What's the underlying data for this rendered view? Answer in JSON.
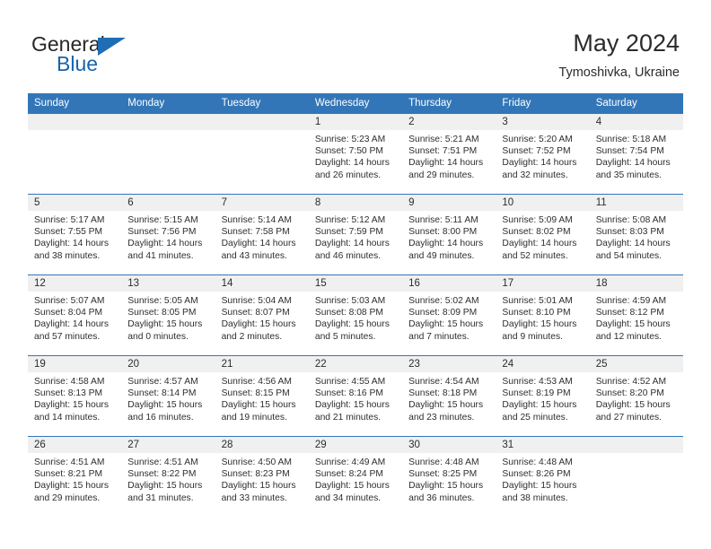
{
  "brand": {
    "word1": "General",
    "word2": "Blue",
    "triangle_icon": "brand-triangle-icon",
    "accent_color": "#1f6eb5"
  },
  "header": {
    "title": "May 2024",
    "subtitle": "Tymoshivka, Ukraine"
  },
  "colors": {
    "header_blue": "#3276b8",
    "daynum_band": "#f0f0f0",
    "text": "#2b2b2b"
  },
  "calendar": {
    "weekday_headers": [
      "Sunday",
      "Monday",
      "Tuesday",
      "Wednesday",
      "Thursday",
      "Friday",
      "Saturday"
    ],
    "labels": {
      "sunrise": "Sunrise:",
      "sunset": "Sunset:",
      "daylight": "Daylight:"
    },
    "weeks": [
      [
        {
          "blank": true
        },
        {
          "blank": true
        },
        {
          "blank": true
        },
        {
          "day": "1",
          "sunrise": "Sunrise: 5:23 AM",
          "sunset": "Sunset: 7:50 PM",
          "daylight_a": "Daylight: 14 hours",
          "daylight_b": "and 26 minutes."
        },
        {
          "day": "2",
          "sunrise": "Sunrise: 5:21 AM",
          "sunset": "Sunset: 7:51 PM",
          "daylight_a": "Daylight: 14 hours",
          "daylight_b": "and 29 minutes."
        },
        {
          "day": "3",
          "sunrise": "Sunrise: 5:20 AM",
          "sunset": "Sunset: 7:52 PM",
          "daylight_a": "Daylight: 14 hours",
          "daylight_b": "and 32 minutes."
        },
        {
          "day": "4",
          "sunrise": "Sunrise: 5:18 AM",
          "sunset": "Sunset: 7:54 PM",
          "daylight_a": "Daylight: 14 hours",
          "daylight_b": "and 35 minutes."
        }
      ],
      [
        {
          "day": "5",
          "sunrise": "Sunrise: 5:17 AM",
          "sunset": "Sunset: 7:55 PM",
          "daylight_a": "Daylight: 14 hours",
          "daylight_b": "and 38 minutes."
        },
        {
          "day": "6",
          "sunrise": "Sunrise: 5:15 AM",
          "sunset": "Sunset: 7:56 PM",
          "daylight_a": "Daylight: 14 hours",
          "daylight_b": "and 41 minutes."
        },
        {
          "day": "7",
          "sunrise": "Sunrise: 5:14 AM",
          "sunset": "Sunset: 7:58 PM",
          "daylight_a": "Daylight: 14 hours",
          "daylight_b": "and 43 minutes."
        },
        {
          "day": "8",
          "sunrise": "Sunrise: 5:12 AM",
          "sunset": "Sunset: 7:59 PM",
          "daylight_a": "Daylight: 14 hours",
          "daylight_b": "and 46 minutes."
        },
        {
          "day": "9",
          "sunrise": "Sunrise: 5:11 AM",
          "sunset": "Sunset: 8:00 PM",
          "daylight_a": "Daylight: 14 hours",
          "daylight_b": "and 49 minutes."
        },
        {
          "day": "10",
          "sunrise": "Sunrise: 5:09 AM",
          "sunset": "Sunset: 8:02 PM",
          "daylight_a": "Daylight: 14 hours",
          "daylight_b": "and 52 minutes."
        },
        {
          "day": "11",
          "sunrise": "Sunrise: 5:08 AM",
          "sunset": "Sunset: 8:03 PM",
          "daylight_a": "Daylight: 14 hours",
          "daylight_b": "and 54 minutes."
        }
      ],
      [
        {
          "day": "12",
          "sunrise": "Sunrise: 5:07 AM",
          "sunset": "Sunset: 8:04 PM",
          "daylight_a": "Daylight: 14 hours",
          "daylight_b": "and 57 minutes."
        },
        {
          "day": "13",
          "sunrise": "Sunrise: 5:05 AM",
          "sunset": "Sunset: 8:05 PM",
          "daylight_a": "Daylight: 15 hours",
          "daylight_b": "and 0 minutes."
        },
        {
          "day": "14",
          "sunrise": "Sunrise: 5:04 AM",
          "sunset": "Sunset: 8:07 PM",
          "daylight_a": "Daylight: 15 hours",
          "daylight_b": "and 2 minutes."
        },
        {
          "day": "15",
          "sunrise": "Sunrise: 5:03 AM",
          "sunset": "Sunset: 8:08 PM",
          "daylight_a": "Daylight: 15 hours",
          "daylight_b": "and 5 minutes."
        },
        {
          "day": "16",
          "sunrise": "Sunrise: 5:02 AM",
          "sunset": "Sunset: 8:09 PM",
          "daylight_a": "Daylight: 15 hours",
          "daylight_b": "and 7 minutes."
        },
        {
          "day": "17",
          "sunrise": "Sunrise: 5:01 AM",
          "sunset": "Sunset: 8:10 PM",
          "daylight_a": "Daylight: 15 hours",
          "daylight_b": "and 9 minutes."
        },
        {
          "day": "18",
          "sunrise": "Sunrise: 4:59 AM",
          "sunset": "Sunset: 8:12 PM",
          "daylight_a": "Daylight: 15 hours",
          "daylight_b": "and 12 minutes."
        }
      ],
      [
        {
          "day": "19",
          "sunrise": "Sunrise: 4:58 AM",
          "sunset": "Sunset: 8:13 PM",
          "daylight_a": "Daylight: 15 hours",
          "daylight_b": "and 14 minutes."
        },
        {
          "day": "20",
          "sunrise": "Sunrise: 4:57 AM",
          "sunset": "Sunset: 8:14 PM",
          "daylight_a": "Daylight: 15 hours",
          "daylight_b": "and 16 minutes."
        },
        {
          "day": "21",
          "sunrise": "Sunrise: 4:56 AM",
          "sunset": "Sunset: 8:15 PM",
          "daylight_a": "Daylight: 15 hours",
          "daylight_b": "and 19 minutes."
        },
        {
          "day": "22",
          "sunrise": "Sunrise: 4:55 AM",
          "sunset": "Sunset: 8:16 PM",
          "daylight_a": "Daylight: 15 hours",
          "daylight_b": "and 21 minutes."
        },
        {
          "day": "23",
          "sunrise": "Sunrise: 4:54 AM",
          "sunset": "Sunset: 8:18 PM",
          "daylight_a": "Daylight: 15 hours",
          "daylight_b": "and 23 minutes."
        },
        {
          "day": "24",
          "sunrise": "Sunrise: 4:53 AM",
          "sunset": "Sunset: 8:19 PM",
          "daylight_a": "Daylight: 15 hours",
          "daylight_b": "and 25 minutes."
        },
        {
          "day": "25",
          "sunrise": "Sunrise: 4:52 AM",
          "sunset": "Sunset: 8:20 PM",
          "daylight_a": "Daylight: 15 hours",
          "daylight_b": "and 27 minutes."
        }
      ],
      [
        {
          "day": "26",
          "sunrise": "Sunrise: 4:51 AM",
          "sunset": "Sunset: 8:21 PM",
          "daylight_a": "Daylight: 15 hours",
          "daylight_b": "and 29 minutes."
        },
        {
          "day": "27",
          "sunrise": "Sunrise: 4:51 AM",
          "sunset": "Sunset: 8:22 PM",
          "daylight_a": "Daylight: 15 hours",
          "daylight_b": "and 31 minutes."
        },
        {
          "day": "28",
          "sunrise": "Sunrise: 4:50 AM",
          "sunset": "Sunset: 8:23 PM",
          "daylight_a": "Daylight: 15 hours",
          "daylight_b": "and 33 minutes."
        },
        {
          "day": "29",
          "sunrise": "Sunrise: 4:49 AM",
          "sunset": "Sunset: 8:24 PM",
          "daylight_a": "Daylight: 15 hours",
          "daylight_b": "and 34 minutes."
        },
        {
          "day": "30",
          "sunrise": "Sunrise: 4:48 AM",
          "sunset": "Sunset: 8:25 PM",
          "daylight_a": "Daylight: 15 hours",
          "daylight_b": "and 36 minutes."
        },
        {
          "day": "31",
          "sunrise": "Sunrise: 4:48 AM",
          "sunset": "Sunset: 8:26 PM",
          "daylight_a": "Daylight: 15 hours",
          "daylight_b": "and 38 minutes."
        },
        {
          "blank": true
        }
      ]
    ]
  }
}
